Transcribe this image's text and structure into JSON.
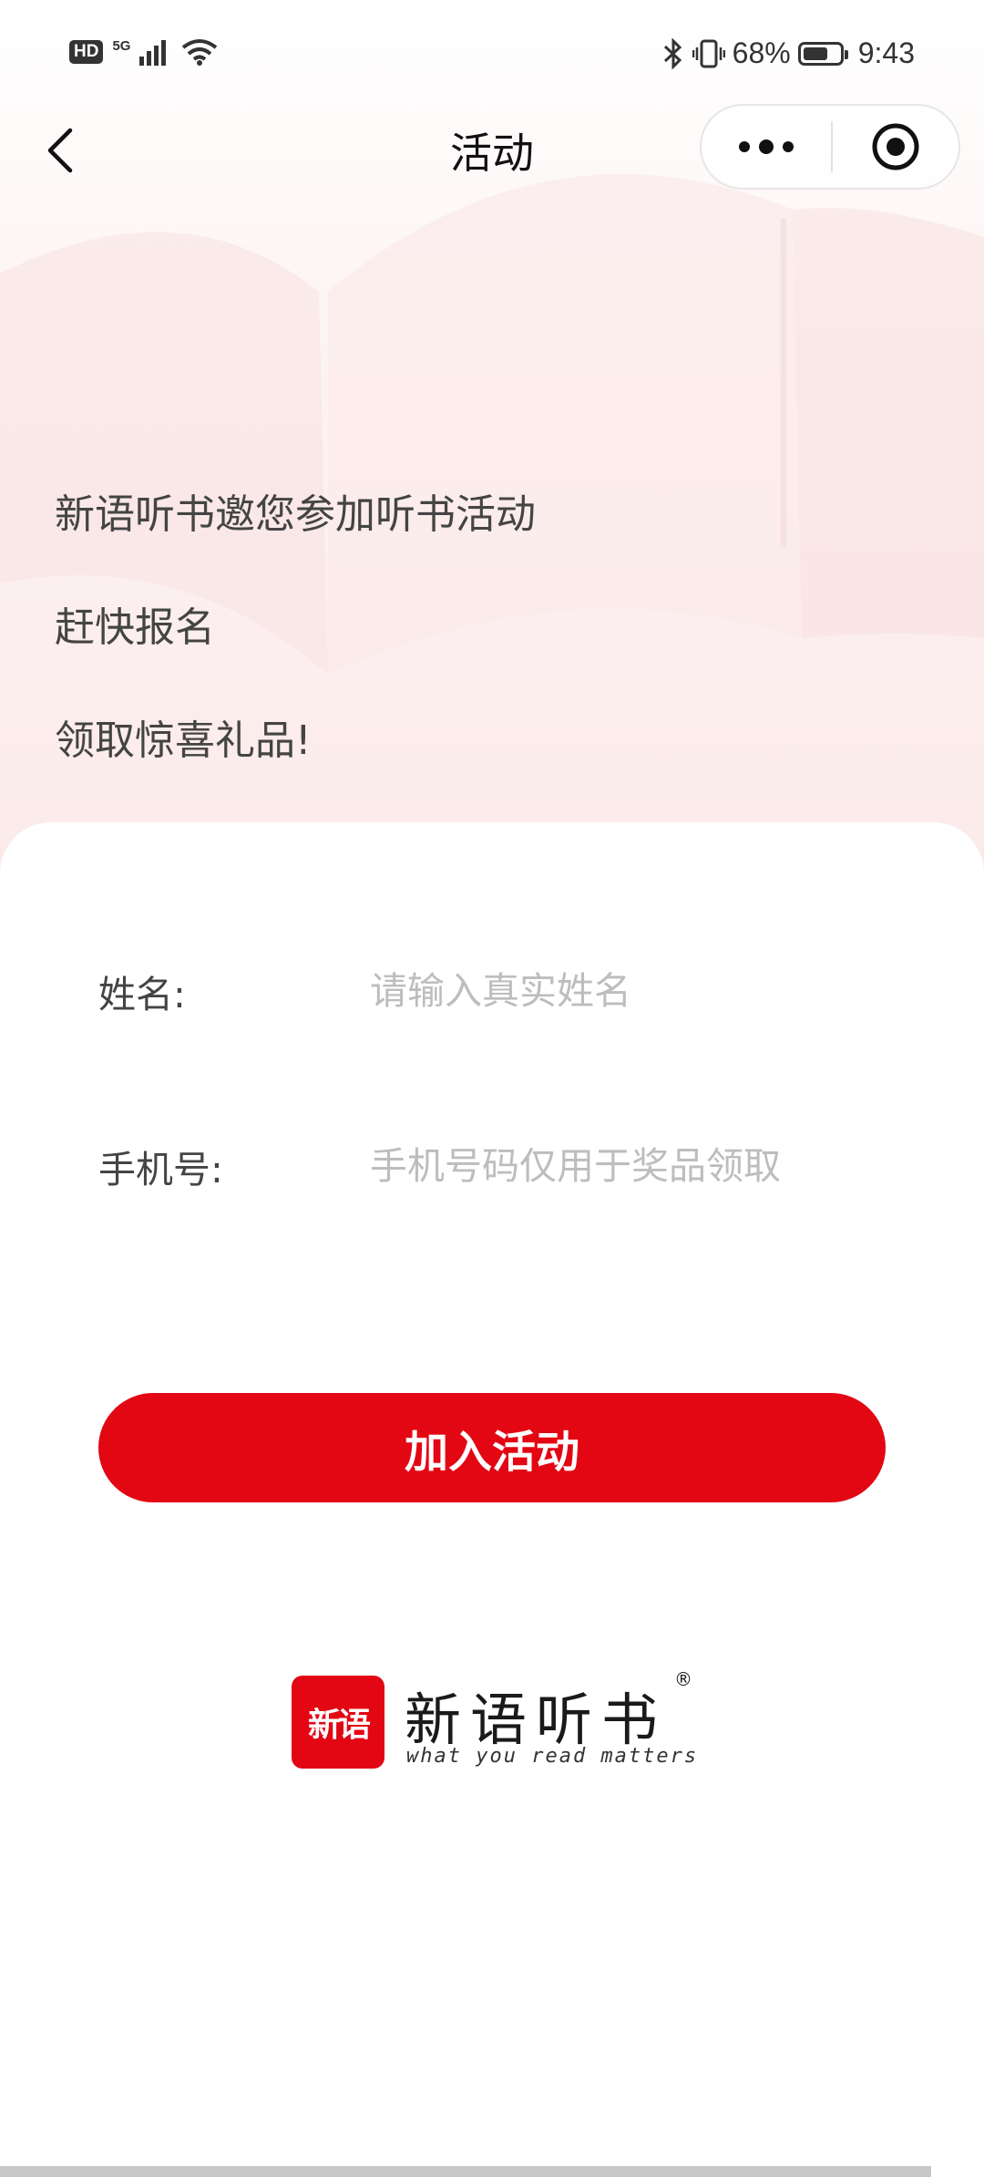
{
  "status_bar": {
    "hd": "HD",
    "network": "5G",
    "battery_percent": "68%",
    "battery_level": 0.68,
    "time": "9:43"
  },
  "nav": {
    "title": "活动"
  },
  "hero": {
    "lines": [
      "新语听书邀您参加听书活动",
      "赶快报名",
      "领取惊喜礼品!"
    ]
  },
  "form": {
    "name_label": "姓名:",
    "name_placeholder": "请输入真实姓名",
    "name_value": "",
    "phone_label": "手机号:",
    "phone_placeholder": "手机号码仅用于奖品领取",
    "phone_value": ""
  },
  "join_button": {
    "label": "加入活动"
  },
  "brand": {
    "mark_text": "新语",
    "name": "新语听书",
    "registered": "®",
    "slogan": "what you read matters"
  },
  "colors": {
    "accent": "#e30613",
    "text": "#444444",
    "placeholder": "#bdbdbd"
  }
}
